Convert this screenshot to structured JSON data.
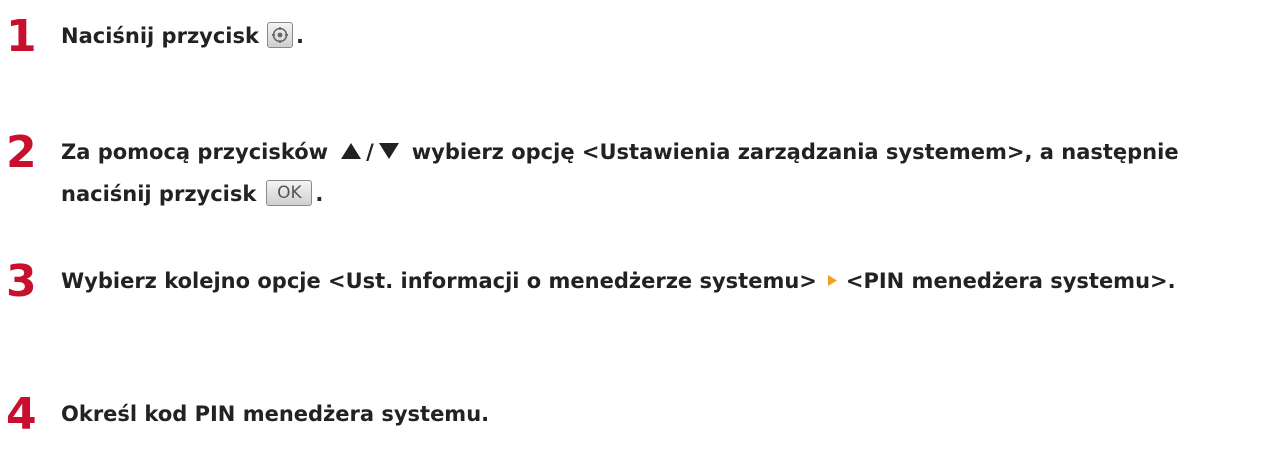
{
  "steps": [
    {
      "number": "1",
      "before": "Naciśnij przycisk",
      "key_icon": "settings-icon",
      "after": "."
    },
    {
      "number": "2",
      "before": "Za pomocą przycisków",
      "up_icon": "up-triangle-icon",
      "separator": "/",
      "down_icon": "down-triangle-icon",
      "middle": "wybierz opcję <Ustawienia zarządzania systemem>, a następnie naciśnij przycisk",
      "key_label": "OK",
      "after": "."
    },
    {
      "number": "3",
      "before": "Wybierz kolejno opcje <Ust. informacji o menedżerze systemu>",
      "arrow_icon": "right-arrow-icon",
      "after": "<PIN menedżera systemu>."
    },
    {
      "number": "4",
      "text": "Określ kod PIN menedżera systemu."
    }
  ],
  "colors": {
    "step_number": "#c8102e",
    "text": "#222222",
    "arrow": "#f0a020"
  }
}
